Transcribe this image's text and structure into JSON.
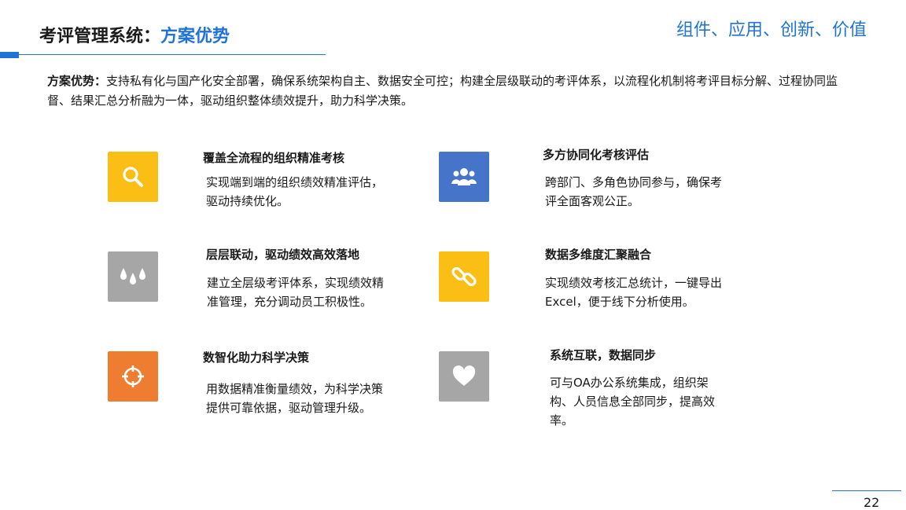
{
  "header": {
    "title_prefix": "考评管理系统：",
    "title_highlight": "方案优势",
    "tagline": "组件、应用、创新、价值"
  },
  "intro": {
    "lead": "方案优势：",
    "text": "支持私有化与国产化安全部署，确保系统架构自主、数据安全可控；构建全层级联动的考评体系，以流程化机制将考评目标分解、过程协同监督、结果汇总分析融为一体，驱动组织整体绩效提升，助力科学决策。"
  },
  "features": [
    {
      "title": "覆盖全流程的组织精准考核",
      "desc": "实现端到端的组织绩效精准评估，驱动持续优化。",
      "icon": "search-icon",
      "color": "#fbbe14"
    },
    {
      "title": "多方协同化考核评估",
      "desc": "跨部门、多角色协同参与，确保考评全面客观公正。",
      "icon": "users-icon",
      "color": "#4574c8"
    },
    {
      "title": "层层联动，驱动绩效高效落地",
      "desc": "建立全层级考评体系，实现绩效精准管理，充分调动员工积极性。",
      "icon": "drops-icon",
      "color": "#a6a6a6"
    },
    {
      "title": "数据多维度汇聚融合",
      "desc": "实现绩效考核汇总统计，一键导出Excel，便于线下分析使用。",
      "icon": "link-icon",
      "color": "#fbbe14"
    },
    {
      "title": "数智化助力科学决策",
      "desc": "用数据精准衡量绩效，为科学决策提供可靠依据，驱动管理升级。",
      "icon": "crosshair-icon",
      "color": "#ef7d31"
    },
    {
      "title": "系统互联，数据同步",
      "desc": "可与OA办公系统集成，组织架构、人员信息全部同步，提高效率。",
      "icon": "heart-icon",
      "color": "#a6a6a6"
    }
  ],
  "footer": {
    "page_number": "22"
  }
}
